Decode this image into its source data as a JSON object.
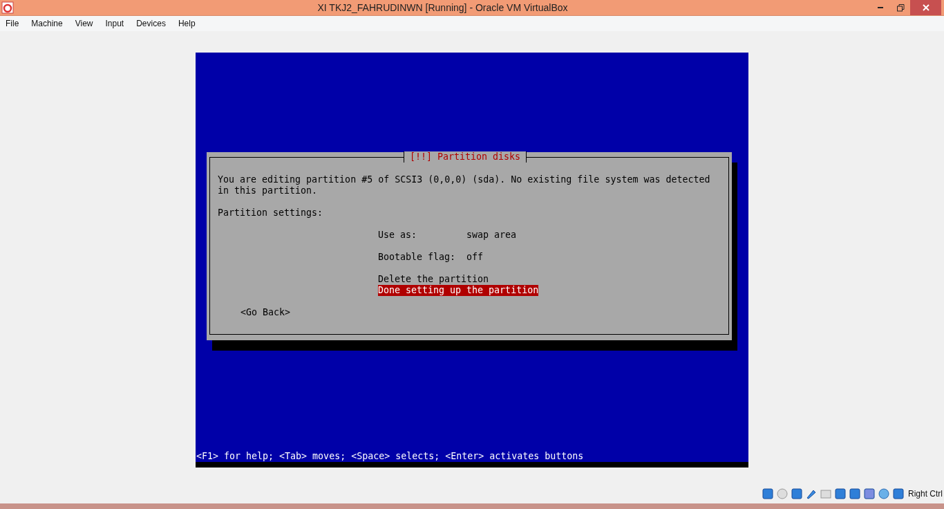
{
  "window": {
    "title": "XI TKJ2_FAHRUDINWN [Running] - Oracle VM VirtualBox"
  },
  "menu": [
    "File",
    "Machine",
    "View",
    "Input",
    "Devices",
    "Help"
  ],
  "dialog": {
    "title": "[!!] Partition disks",
    "message": "You are editing partition #5 of SCSI3 (0,0,0) (sda). No existing file system was detected in this partition.",
    "section": "Partition settings:",
    "items": [
      {
        "kind": "setting",
        "label": "Use as:",
        "value": "swap area",
        "selected": false
      },
      {
        "kind": "setting",
        "label": "Bootable flag:",
        "value": "off",
        "selected": false
      },
      {
        "kind": "action",
        "label": "Delete the partition",
        "selected": false
      },
      {
        "kind": "action",
        "label": "Done setting up the partition",
        "selected": true
      }
    ],
    "back_button": "<Go Back>"
  },
  "help_line": "<F1> for help; <Tab> moves; <Space> selects; <Enter> activates buttons",
  "status_bar": {
    "host_key": "Right Ctrl"
  }
}
